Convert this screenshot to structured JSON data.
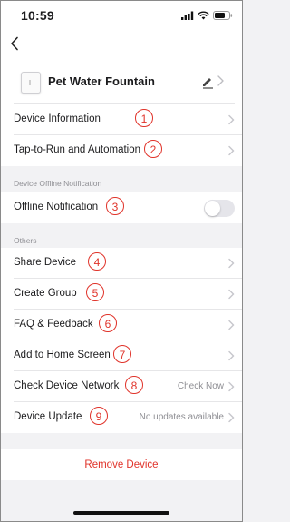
{
  "status": {
    "time": "10:59"
  },
  "device": {
    "name": "Pet Water Fountain"
  },
  "rows": [
    {
      "label": "Device Information",
      "num": "1",
      "value": ""
    },
    {
      "label": "Tap-to-Run and Automation",
      "num": "2",
      "value": ""
    },
    {
      "label": "Offline Notification",
      "num": "3",
      "value": "",
      "toggle_on": false
    },
    {
      "label": "Share Device",
      "num": "4",
      "value": ""
    },
    {
      "label": "Create Group",
      "num": "5",
      "value": ""
    },
    {
      "label": "FAQ & Feedback",
      "num": "6",
      "value": ""
    },
    {
      "label": "Add to Home Screen",
      "num": "7",
      "value": ""
    },
    {
      "label": "Check Device Network",
      "num": "8",
      "value": "Check Now"
    },
    {
      "label": "Device Update",
      "num": "9",
      "value": "No updates available"
    }
  ],
  "sections": {
    "offline": "Device Offline Notification",
    "others": "Others"
  },
  "remove_label": "Remove Device",
  "colors": {
    "accent": "#e0332a",
    "background": "#f2f2f4"
  }
}
